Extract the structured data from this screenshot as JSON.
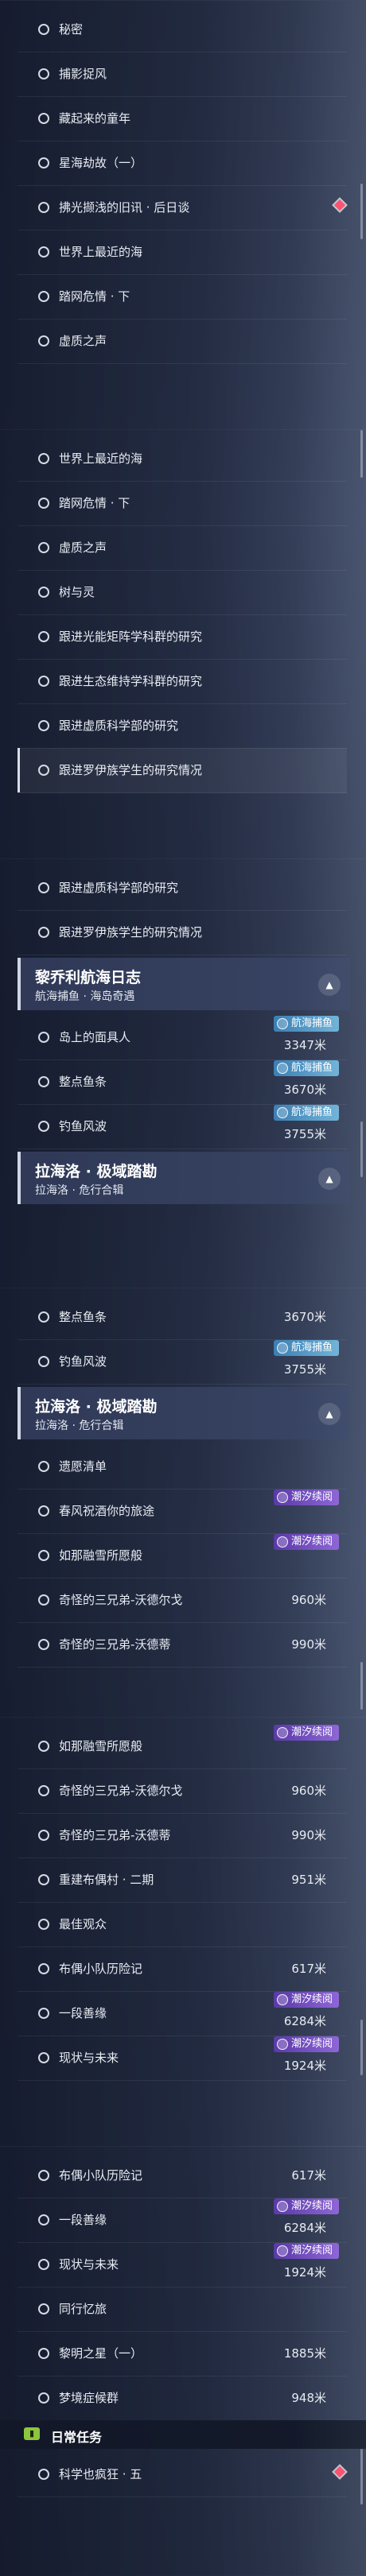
{
  "colors": {
    "tag_blue": "#5fa6d0",
    "tag_purple": "#7a52c8",
    "new_marker": "#ff4d6d",
    "daily_icon": "#8cc63f"
  },
  "panels": [
    {
      "name": "panel-1",
      "items": [
        {
          "type": "row",
          "label": "秘密"
        },
        {
          "type": "row",
          "label": "捕影捉风"
        },
        {
          "type": "row",
          "label": "藏起来的童年"
        },
        {
          "type": "row",
          "label": "星海劫故（一）"
        },
        {
          "type": "row",
          "label": "拂光撷浅的旧讯 · 后日谈",
          "marker": "new-marker"
        },
        {
          "type": "row",
          "label": "世界上最近的海"
        },
        {
          "type": "row",
          "label": "踏网危情 · 下"
        },
        {
          "type": "row",
          "label": "虚质之声"
        }
      ]
    },
    {
      "name": "panel-2",
      "items": [
        {
          "type": "row",
          "label": "世界上最近的海"
        },
        {
          "type": "row",
          "label": "踏网危情 · 下"
        },
        {
          "type": "row",
          "label": "虚质之声"
        },
        {
          "type": "row",
          "label": "树与灵"
        },
        {
          "type": "row",
          "label": "跟进光能矩阵学科群的研究"
        },
        {
          "type": "row",
          "label": "跟进生态维持学科群的研究"
        },
        {
          "type": "row",
          "label": "跟进虚质科学部的研究"
        },
        {
          "type": "row",
          "label": "跟进罗伊族学生的研究情况",
          "selected": true
        }
      ]
    },
    {
      "name": "panel-3",
      "items": [
        {
          "type": "row",
          "label": "跟进虚质科学部的研究"
        },
        {
          "type": "row",
          "label": "跟进罗伊族学生的研究情况"
        },
        {
          "type": "header",
          "title": "黎乔利航海日志",
          "subtitle": "航海捕鱼 · 海岛奇遇",
          "toggle": "▲"
        },
        {
          "type": "row",
          "label": "岛上的面具人",
          "tag": "航海捕鱼",
          "tag_color": "blue",
          "distance": "3347米"
        },
        {
          "type": "row",
          "label": "整点鱼条",
          "tag": "航海捕鱼",
          "tag_color": "blue",
          "distance": "3670米"
        },
        {
          "type": "row",
          "label": "钓鱼风波",
          "tag": "航海捕鱼",
          "tag_color": "blue",
          "distance": "3755米"
        },
        {
          "type": "header",
          "title": "拉海洛 · 极域踏勘",
          "subtitle": "拉海洛 · 危行合辑",
          "toggle": "▲"
        }
      ]
    },
    {
      "name": "panel-4",
      "items": [
        {
          "type": "row",
          "label": "整点鱼条",
          "distance": "3670米"
        },
        {
          "type": "row",
          "label": "钓鱼风波",
          "tag": "航海捕鱼",
          "tag_color": "blue",
          "distance": "3755米"
        },
        {
          "type": "header",
          "title": "拉海洛 · 极域踏勘",
          "subtitle": "拉海洛 · 危行合辑",
          "toggle": "▲"
        },
        {
          "type": "row",
          "label": "遗愿清单"
        },
        {
          "type": "row",
          "label": "春风祝酒你的旅途",
          "tag": "潮汐续阅",
          "tag_color": "purple"
        },
        {
          "type": "row",
          "label": "如那融雪所愿般",
          "tag": "潮汐续阅",
          "tag_color": "purple"
        },
        {
          "type": "row",
          "label": "奇怪的三兄弟-沃德尔戈",
          "distance": "960米"
        },
        {
          "type": "row",
          "label": "奇怪的三兄弟-沃德蒂",
          "distance": "990米"
        }
      ]
    },
    {
      "name": "panel-5",
      "items": [
        {
          "type": "row",
          "label": "如那融雪所愿般",
          "tag": "潮汐续阅",
          "tag_color": "purple"
        },
        {
          "type": "row",
          "label": "奇怪的三兄弟-沃德尔戈",
          "distance": "960米"
        },
        {
          "type": "row",
          "label": "奇怪的三兄弟-沃德蒂",
          "distance": "990米"
        },
        {
          "type": "row",
          "label": "重建布偶村 · 二期",
          "distance": "951米"
        },
        {
          "type": "row",
          "label": "最佳观众"
        },
        {
          "type": "row",
          "label": "布偶小队历险记",
          "distance": "617米"
        },
        {
          "type": "row",
          "label": "一段善缘",
          "tag": "潮汐续阅",
          "tag_color": "purple",
          "distance": "6284米"
        },
        {
          "type": "row",
          "label": "现状与未来",
          "tag": "潮汐续阅",
          "tag_color": "purple",
          "distance": "1924米"
        }
      ]
    },
    {
      "name": "panel-6",
      "items": [
        {
          "type": "row",
          "label": "布偶小队历险记",
          "distance": "617米"
        },
        {
          "type": "row",
          "label": "一段善缘",
          "tag": "潮汐续阅",
          "tag_color": "purple",
          "distance": "6284米"
        },
        {
          "type": "row",
          "label": "现状与未来",
          "tag": "潮汐续阅",
          "tag_color": "purple",
          "distance": "1924米"
        },
        {
          "type": "row",
          "label": "同行忆旅"
        },
        {
          "type": "row",
          "label": "黎明之星（一）",
          "distance": "1885米"
        },
        {
          "type": "row",
          "label": "梦境症候群",
          "distance": "948米"
        },
        {
          "type": "daily",
          "title": "日常任务",
          "icon": "daily-task-icon"
        },
        {
          "type": "row",
          "label": "科学也疯狂 · 五",
          "marker": "new-marker"
        }
      ]
    }
  ]
}
